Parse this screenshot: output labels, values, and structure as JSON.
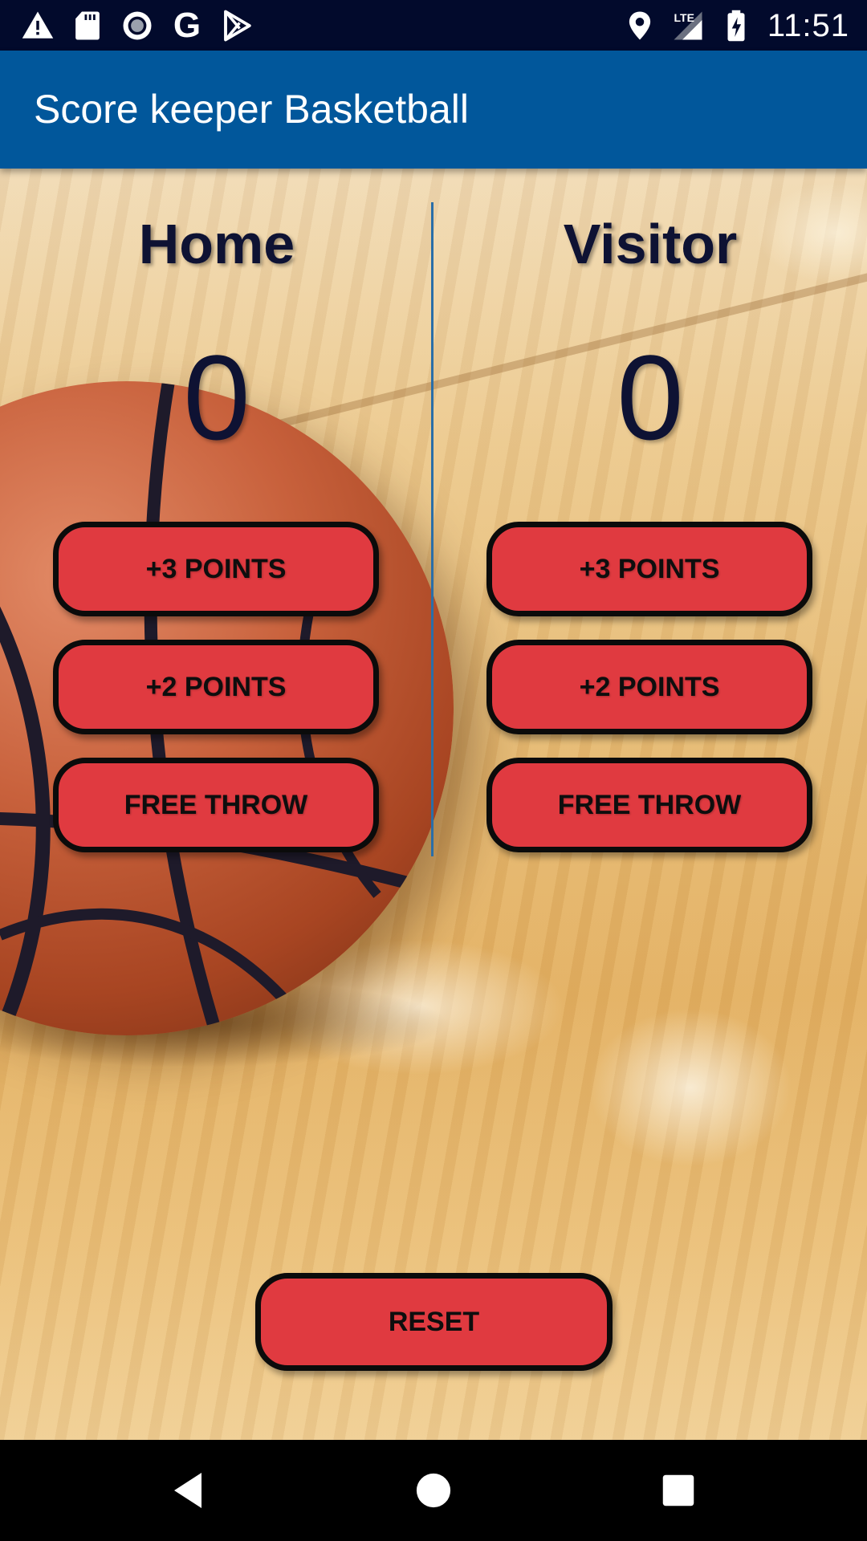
{
  "status_bar": {
    "time": "11:51",
    "google_letter": "G",
    "network_label": "LTE",
    "icons": [
      "warning-icon",
      "sd-card-icon",
      "circle-record-icon",
      "google-icon",
      "play-store-icon",
      "location-pin-icon",
      "signal-icon",
      "battery-charging-icon"
    ]
  },
  "app_bar": {
    "title": "Score keeper Basketball"
  },
  "home": {
    "team_label": "Home",
    "score": "0",
    "three_points_label": "+3 POINTS",
    "two_points_label": "+2 POINTS",
    "free_throw_label": "FREE THROW"
  },
  "visitor": {
    "team_label": "Visitor",
    "score": "0",
    "three_points_label": "+3 POINTS",
    "two_points_label": "+2 POINTS",
    "free_throw_label": "FREE THROW"
  },
  "reset_label": "RESET",
  "colors": {
    "app_bar": "#01579b",
    "status_bar": "#020a2c",
    "button": "#e03a40",
    "button_border": "#0b0b0b",
    "text_dark": "#0e1233",
    "divider": "#2a6ea8"
  },
  "nav_bar": {
    "icons": [
      "back-icon",
      "home-circle-icon",
      "recents-square-icon"
    ]
  }
}
